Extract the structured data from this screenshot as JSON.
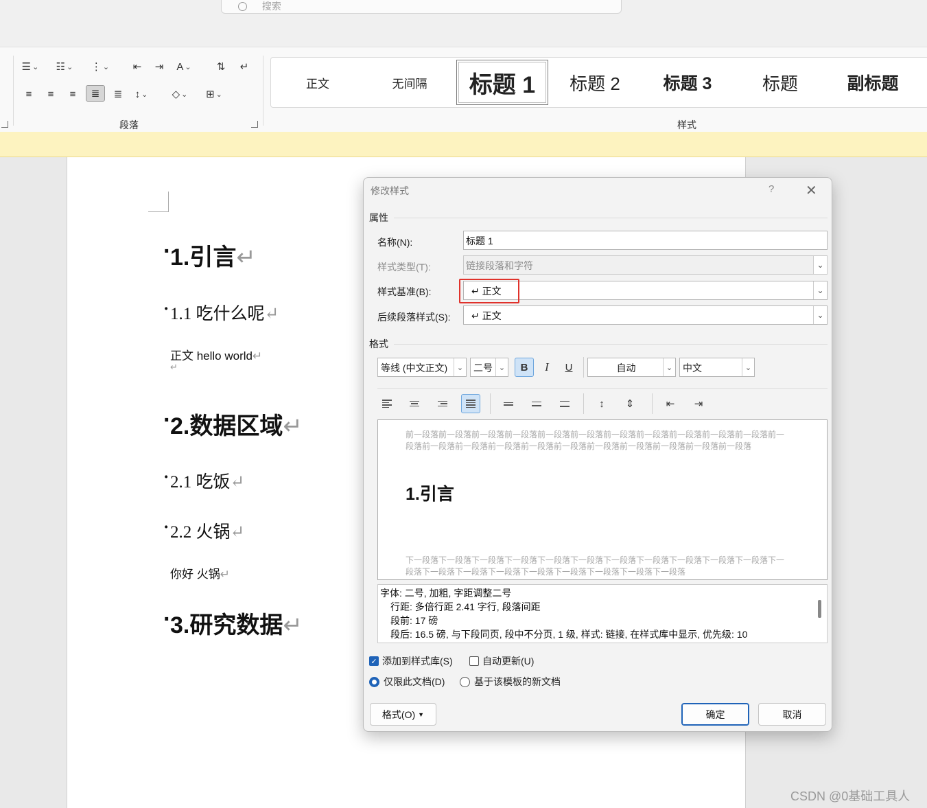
{
  "search": {
    "placeholder": "搜索"
  },
  "ribbon": {
    "paragraph_group_label": "段落",
    "styles_group_label": "样式",
    "styles": [
      {
        "label": "正文"
      },
      {
        "label": "无间隔"
      },
      {
        "label": "标题 1",
        "selected": true
      },
      {
        "label": "标题 2"
      },
      {
        "label": "标题 3"
      },
      {
        "label": "标题"
      },
      {
        "label": "副标题"
      }
    ]
  },
  "document": {
    "pilcrow": "↵",
    "lines": [
      {
        "text": "1.引言",
        "style": "h1"
      },
      {
        "text": "1.1  吃什么呢",
        "style": "h2"
      },
      {
        "text": "正文  hello world",
        "style": "body"
      },
      {
        "text": "",
        "style": "body"
      },
      {
        "text": "2.数据区域",
        "style": "h1"
      },
      {
        "text": "2.1 吃饭",
        "style": "h2"
      },
      {
        "text": "2.2 火锅",
        "style": "h2"
      },
      {
        "text": "你好  火锅",
        "style": "body"
      },
      {
        "text": "3.研究数据",
        "style": "h1"
      }
    ]
  },
  "dialog": {
    "title": "修改样式",
    "help": "?",
    "close": "✕",
    "properties_label": "属性",
    "name_label": "名称(N):",
    "name_value": "标题 1",
    "type_label": "样式类型(T):",
    "type_value": "链接段落和字符",
    "based_on_label": "样式基准(B):",
    "based_on_value": "↵ 正文",
    "following_label": "后续段落样式(S):",
    "following_value": "↵ 正文",
    "format_label": "格式",
    "font": "等线 (中文正文)",
    "size": "二号",
    "bold": "B",
    "italic": "I",
    "underline": "U",
    "color": "自动",
    "language": "中文",
    "preview": {
      "prev_para": "前一段落前一段落前一段落前一段落前一段落前一段落前一段落前一段落前一段落前一段落前一段落前一段落前一段落前一段落前一段落前一段落前一段落前一段落前一段落前一段落前一段落前一段落",
      "sample": "1.引言",
      "next_para": "下一段落下一段落下一段落下一段落下一段落下一段落下一段落下一段落下一段落下一段落下一段落下一段落下一段落下一段落下一段落下一段落下一段落下一段落下一段落下一段落"
    },
    "description": [
      "字体: 二号, 加粗, 字距调整二号",
      "行距: 多倍行距 2.41 字行, 段落间距",
      "段前: 17 磅",
      "段后: 16.5 磅, 与下段同页, 段中不分页, 1 级, 样式: 链接, 在样式库中显示, 优先级: 10"
    ],
    "add_to_gallery": "添加到样式库(S)",
    "auto_update": "自动更新(U)",
    "only_this_doc": "仅限此文档(D)",
    "new_docs_template": "基于该模板的新文档",
    "format_button": "格式(O)",
    "ok": "确定",
    "cancel": "取消"
  },
  "watermark": "CSDN @0基础工具人"
}
